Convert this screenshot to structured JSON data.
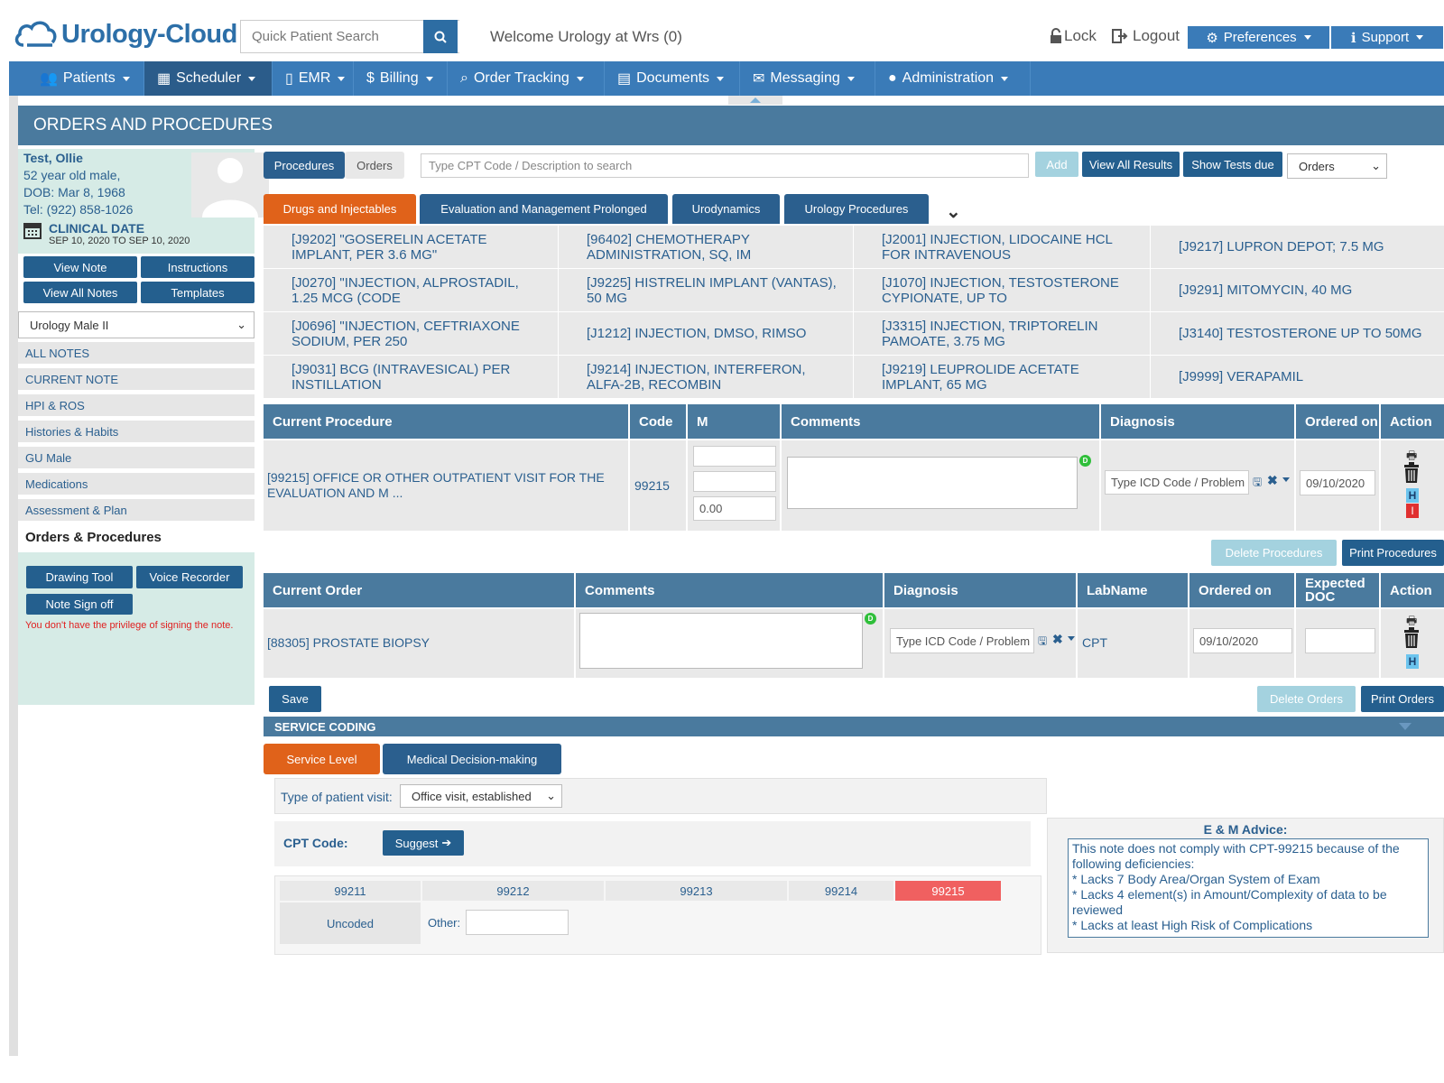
{
  "header": {
    "logo_text": "Urology-Cloud",
    "search_placeholder": "Quick Patient Search",
    "welcome": "Welcome Urology at Wrs (0)",
    "lock_label": "Lock",
    "logout_label": "Logout",
    "preferences_label": "Preferences",
    "support_label": "Support"
  },
  "nav": {
    "items": [
      "Patients",
      "Scheduler",
      "EMR",
      "Billing",
      "Order Tracking",
      "Documents",
      "Messaging",
      "Administration"
    ],
    "active": "Scheduler"
  },
  "page_title": "ORDERS AND PROCEDURES",
  "patient": {
    "name": "Test, Ollie",
    "age_sex": "52 year old male,",
    "dob": "DOB: Mar 8, 1968",
    "tel": "Tel: (922) 858-1026",
    "clinical_date_label": "CLINICAL DATE",
    "clinical_date_value": "SEP 10, 2020 TO SEP 10, 2020"
  },
  "sidebar": {
    "view_note": "View Note",
    "instructions": "Instructions",
    "view_all_notes": "View All Notes",
    "templates": "Templates",
    "template_select": "Urology Male II",
    "links": [
      "ALL NOTES",
      "CURRENT NOTE",
      "HPI & ROS",
      "Histories & Habits",
      "GU Male",
      "Medications",
      "Assessment & Plan"
    ],
    "active_link": "Orders & Procedures",
    "drawing_tool": "Drawing Tool",
    "voice_recorder": "Voice Recorder",
    "note_sign_off": "Note Sign off",
    "warning": "You don't have the privilege of signing the note."
  },
  "toolbar": {
    "tab_procedures": "Procedures",
    "tab_orders": "Orders",
    "cpt_placeholder": "Type CPT Code / Description to search",
    "add": "Add",
    "view_all_results": "View All Results",
    "show_tests_due": "Show Tests due",
    "orders_select": "Orders"
  },
  "categories": [
    "Drugs and Injectables",
    "Evaluation and Management Prolonged",
    "Urodynamics",
    "Urology Procedures"
  ],
  "procedures": [
    "[J9202] \"GOSERELIN ACETATE IMPLANT, PER 3.6 MG\"",
    "[96402] CHEMOTHERAPY ADMINISTRATION, SQ, IM",
    "[J2001] INJECTION, LIDOCAINE HCL FOR INTRAVENOUS",
    "[J9217] LUPRON DEPOT; 7.5 MG",
    "[J0270] \"INJECTION, ALPROSTADIL, 1.25 MCG (CODE",
    "[J9225] HISTRELIN IMPLANT (VANTAS), 50 MG",
    "[J1070] INJECTION, TESTOSTERONE CYPIONATE, UP TO",
    "[J9291] MITOMYCIN, 40 MG",
    "[J0696] \"INJECTION, CEFTRIAXONE SODIUM, PER 250",
    "[J1212] INJECTION, DMSO, RIMSO",
    "[J3315] INJECTION, TRIPTORELIN PAMOATE, 3.75 MG",
    "[J3140] TESTOSTERONE UP TO 50MG",
    "[J9031] BCG (INTRAVESICAL) PER INSTILLATION",
    "[J9214] INJECTION, INTERFERON, ALFA-2B, RECOMBIN",
    "[J9219] LEUPROLIDE ACETATE IMPLANT, 65 MG",
    "[J9999] VERAPAMIL"
  ],
  "proc_table": {
    "headers": [
      "Current Procedure",
      "Code",
      "M",
      "Comments",
      "Diagnosis",
      "Ordered on",
      "Action"
    ],
    "row": {
      "procedure": "[99215] OFFICE OR OTHER OUTPATIENT VISIT FOR THE EVALUATION AND M ...",
      "code": "99215",
      "m3": "0.00",
      "diagnosis_placeholder": "Type ICD Code / Problem",
      "ordered_on": "09/10/2020"
    },
    "delete_btn": "Delete Procedures",
    "print_btn": "Print Procedures"
  },
  "order_table": {
    "headers": [
      "Current Order",
      "Comments",
      "Diagnosis",
      "LabName",
      "Ordered on",
      "Expected DOC",
      "Action"
    ],
    "row": {
      "order": "[88305] PROSTATE BIOPSY",
      "diagnosis_placeholder": "Type ICD Code / Problem",
      "labname": "CPT",
      "ordered_on": "09/10/2020"
    },
    "save_btn": "Save",
    "delete_btn": "Delete Orders",
    "print_btn": "Print Orders"
  },
  "service_coding": {
    "title": "SERVICE CODING",
    "tab_service_level": "Service Level",
    "tab_mdm": "Medical Decision-making",
    "visit_label": "Type of patient visit:",
    "visit_value": "Office visit, established",
    "cpt_label": "CPT Code:",
    "suggest": "Suggest",
    "codes": [
      "99211",
      "99212",
      "99213",
      "99214",
      "99215"
    ],
    "selected_code": "99215",
    "uncoded": "Uncoded",
    "other_label": "Other:",
    "advice_title": "E & M Advice:",
    "advice_lines": [
      "This note does not comply with CPT-99215 because of the following deficiencies:",
      "* Lacks 7 Body Area/Organ System of Exam",
      "* Lacks 4 element(s) in Amount/Complexity of data to be reviewed",
      "* Lacks at least High Risk of Complications"
    ]
  },
  "colors": {
    "brand_blue": "#3a7bb8",
    "dark_blue": "#245f8e",
    "orange": "#e0621a",
    "selected_red": "#f06060"
  }
}
